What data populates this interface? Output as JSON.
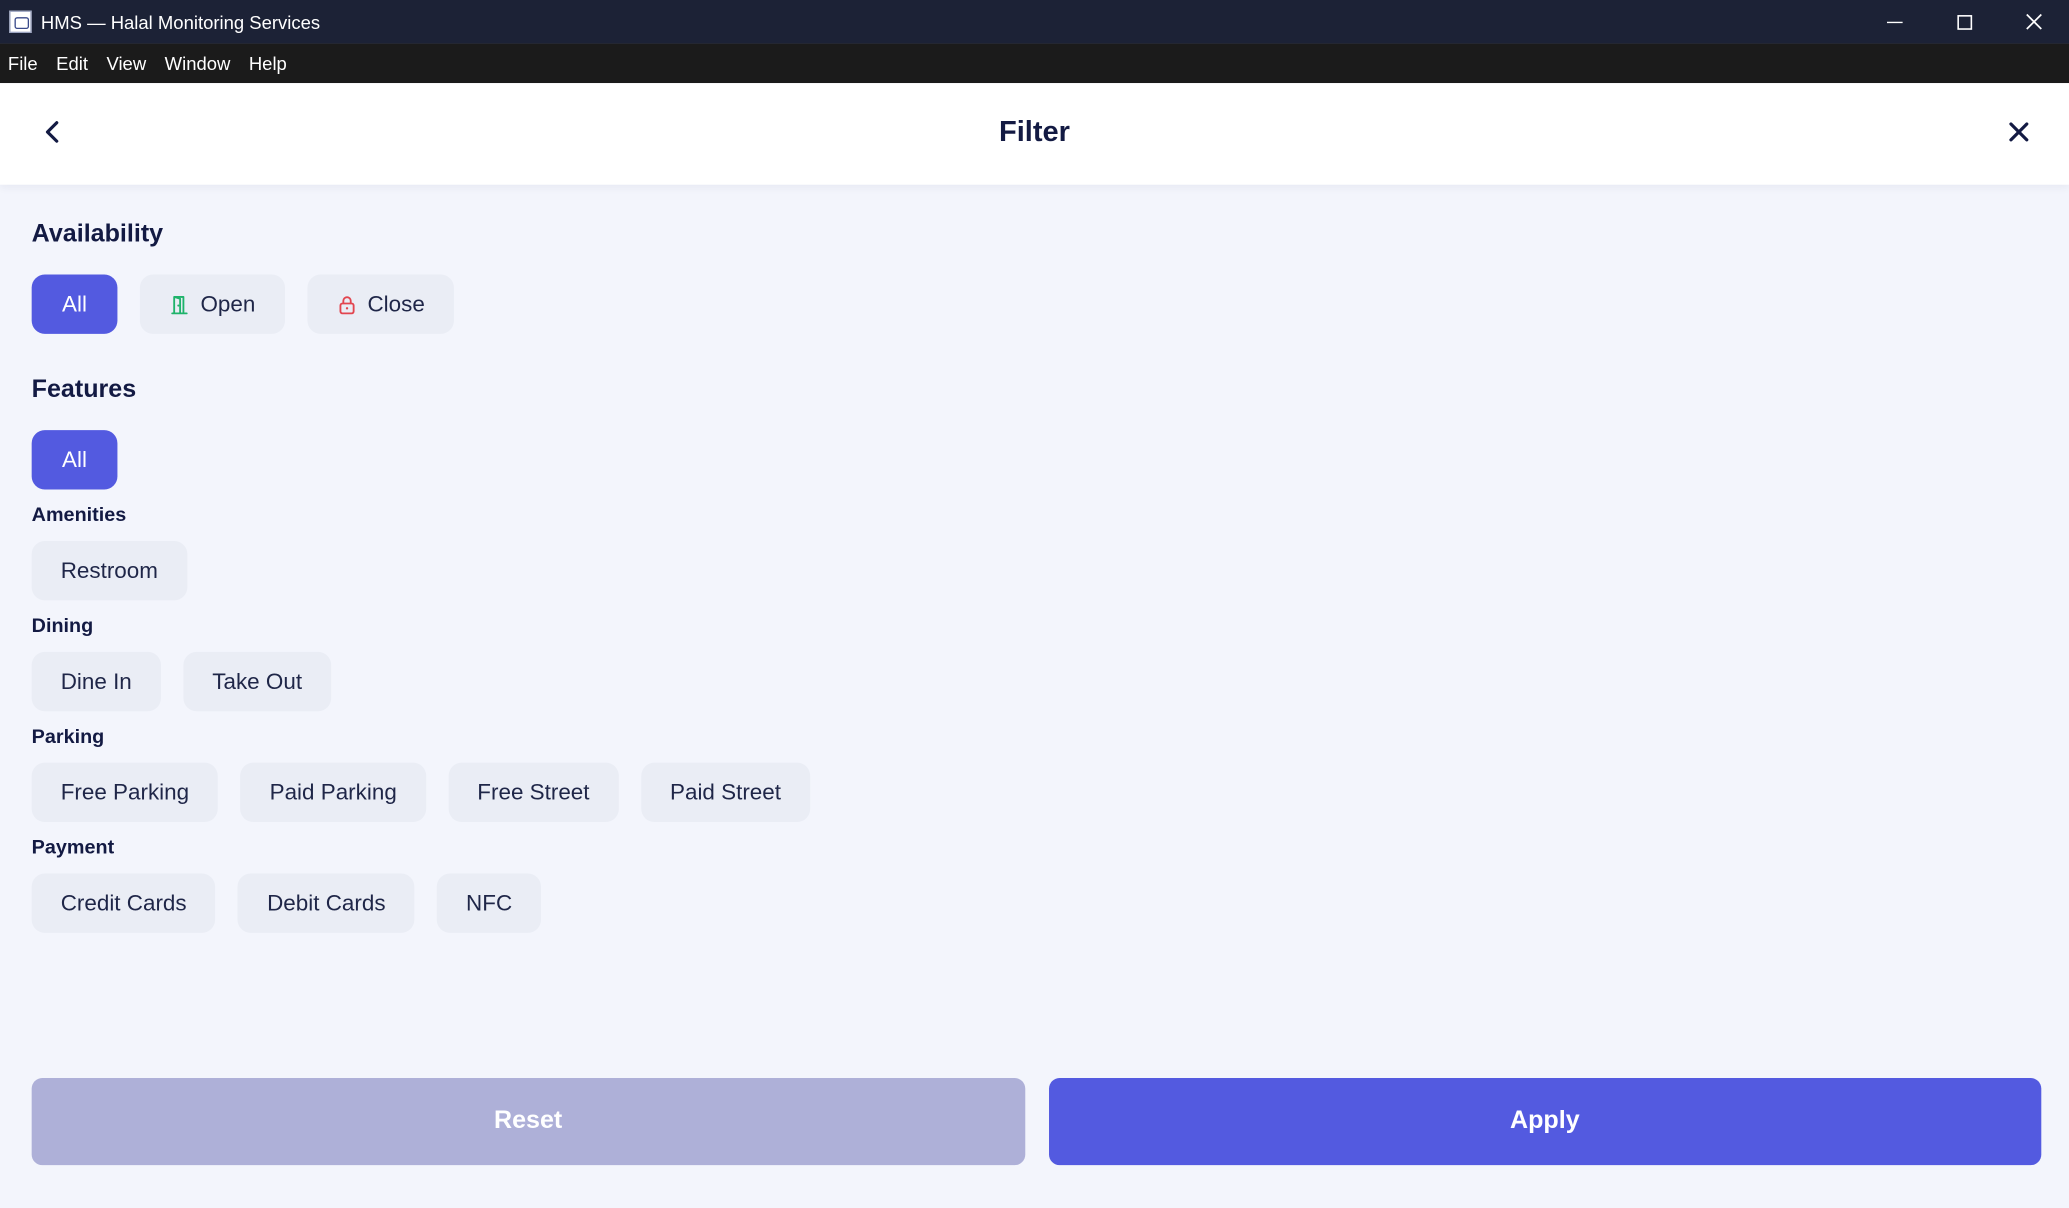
{
  "window": {
    "title": "HMS — Halal Monitoring Services",
    "controls": {
      "minimize": "—",
      "maximize": "☐",
      "close": "✕"
    }
  },
  "menu": [
    "File",
    "Edit",
    "View",
    "Window",
    "Help"
  ],
  "header": {
    "title": "Filter"
  },
  "availability": {
    "title": "Availability",
    "options": [
      {
        "label": "All",
        "icon": "none",
        "selected": true
      },
      {
        "label": "Open",
        "icon": "door-open-icon",
        "selected": false
      },
      {
        "label": "Close",
        "icon": "lock-icon",
        "selected": false
      }
    ]
  },
  "features": {
    "title": "Features",
    "all_label": "All",
    "groups": [
      {
        "title": "Amenities",
        "options": [
          "Restroom"
        ]
      },
      {
        "title": "Dining",
        "options": [
          "Dine In",
          "Take Out"
        ]
      },
      {
        "title": "Parking",
        "options": [
          "Free Parking",
          "Paid Parking",
          "Free Street",
          "Paid Street"
        ]
      },
      {
        "title": "Payment",
        "options": [
          "Credit Cards",
          "Debit Cards",
          "NFC"
        ]
      }
    ]
  },
  "actions": {
    "reset_label": "Reset",
    "apply_label": "Apply"
  },
  "colors": {
    "accent": "#535ae0",
    "reset_disabled": "#aeb0d8",
    "chip_bg": "#eaedf5",
    "open_icon": "#1fb36b",
    "close_icon": "#e2454f",
    "title_text": "#131a43"
  }
}
